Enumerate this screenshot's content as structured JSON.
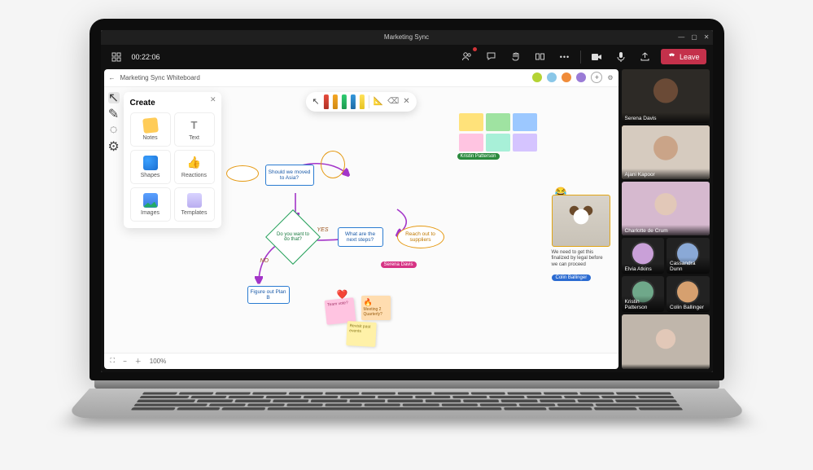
{
  "window": {
    "title": "Marketing Sync",
    "minimize": "—",
    "maximize": "▢",
    "close": "✕"
  },
  "meeting_bar": {
    "timer": "00:22:06",
    "leave_label": "Leave",
    "icons": {
      "grid": "grid-icon",
      "participants": "people-icon",
      "chat": "chat-icon",
      "reactions": "hand-icon",
      "rooms": "rooms-icon",
      "more": "more-icon",
      "camera": "camera-icon",
      "mic": "mic-icon",
      "share": "share-icon"
    }
  },
  "whiteboard": {
    "title": "Marketing Sync Whiteboard",
    "back_icon": "←",
    "collaborators_extra": "+",
    "footer": {
      "zoom": "100%"
    },
    "toolrail": {
      "select": "↖",
      "draw": "✎",
      "eraser": "◌",
      "settings": "⚙"
    },
    "create_panel": {
      "title": "Create",
      "items": [
        {
          "label": "Notes",
          "icon": "note-icon"
        },
        {
          "label": "Text",
          "icon": "text-icon"
        },
        {
          "label": "Shapes",
          "icon": "shape-icon"
        },
        {
          "label": "Reactions",
          "icon": "reaction-icon"
        },
        {
          "label": "Images",
          "icon": "image-icon"
        },
        {
          "label": "Templates",
          "icon": "template-icon"
        }
      ]
    },
    "pen_toolbar": {
      "cursor": "↖",
      "ruler": "📐",
      "eraser": "⌫",
      "close": "✕"
    },
    "palette_tag": "Kristin Patterson",
    "nodes": {
      "move_asia": "Should we moved to Asia?",
      "do_that": "Do you want to do that?",
      "next_steps": "What are the next steps?",
      "reach_out": "Reach out to suppliers",
      "figure_out": "Figure out Plan B",
      "yes": "YES",
      "no": "NO"
    },
    "stickies": {
      "pink": "Team vote?",
      "orange_title": "Meeting 2",
      "orange_sub": "Quarterly?",
      "yellow": "Revisit past events"
    },
    "cursor_tags": {
      "serena": "Serena Davis",
      "colin": "Colin Ballinger"
    },
    "dog": {
      "caption": "We need to get this finalized by legal before we can proceed",
      "emoji": "😂"
    }
  },
  "roster": [
    {
      "name": "Serena Davis",
      "speaking": false
    },
    {
      "name": "Ajani Kapoor",
      "speaking": true
    },
    {
      "name": "Charlotte de Crum",
      "speaking": false
    },
    {
      "name": "Elvia Atkins",
      "speaking": false
    },
    {
      "name": "Cassandra Dunn",
      "speaking": false
    },
    {
      "name": "Kristin Patterson",
      "speaking": false
    },
    {
      "name": "Colin Ballinger",
      "speaking": false
    },
    {
      "name": "",
      "speaking": false
    }
  ]
}
